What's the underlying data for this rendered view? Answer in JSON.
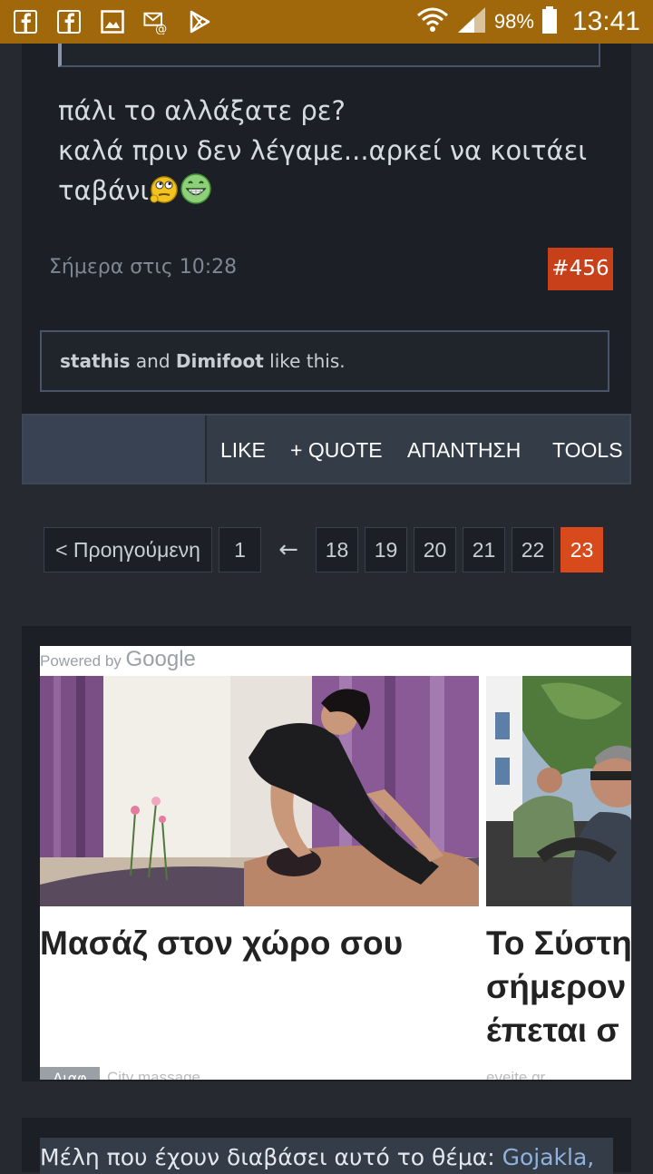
{
  "status_bar": {
    "battery_percent": "98%",
    "time": "13:41",
    "icons": [
      "facebook-icon",
      "facebook-icon",
      "gallery-icon",
      "email-icon",
      "play-store-icon",
      "wifi-icon",
      "signal-icon",
      "battery-icon"
    ]
  },
  "post": {
    "text_lines": [
      "πάλι το αλλάξατε ρε?",
      "καλά πριν δεν λέγαμε...αρκεί να κοιτάει",
      "ταβάνι"
    ],
    "timestamp": "Σήμερα στις 10:28",
    "number": "#456",
    "likes": {
      "user1": "stathis",
      "connector": " and ",
      "user2": "Dimifoot",
      "suffix": " like this."
    }
  },
  "actions": {
    "like": "LIKE",
    "quote": "+ QUOTE",
    "reply": "ΑΠΑΝΤΗΣΗ",
    "tools": "TOOLS"
  },
  "pagination": {
    "prev": "< Προηγούμενη",
    "first": "1",
    "arrow": "←",
    "pages": [
      "18",
      "19",
      "20",
      "21",
      "22",
      "23"
    ],
    "current": "23"
  },
  "ad": {
    "powered_by": "Powered by",
    "google": "Google",
    "cards": [
      {
        "title_lines": [
          "Μασάζ στον χώρο σου"
        ],
        "label": "Διαφ",
        "source": "City massage"
      },
      {
        "title_lines": [
          "Το Σύστη",
          "σήμερον",
          "έπεται σ"
        ],
        "source": "eveite.gr"
      }
    ]
  },
  "readers": {
    "label": "Μέλη που έχουν διαβάσει αυτό το θέμα: ",
    "first_user": "Gojakla,"
  },
  "colors": {
    "status_bar": "#a0680a",
    "accent": "#d84a1b",
    "panel": "#1c1f25",
    "page_bg": "#262a30"
  }
}
